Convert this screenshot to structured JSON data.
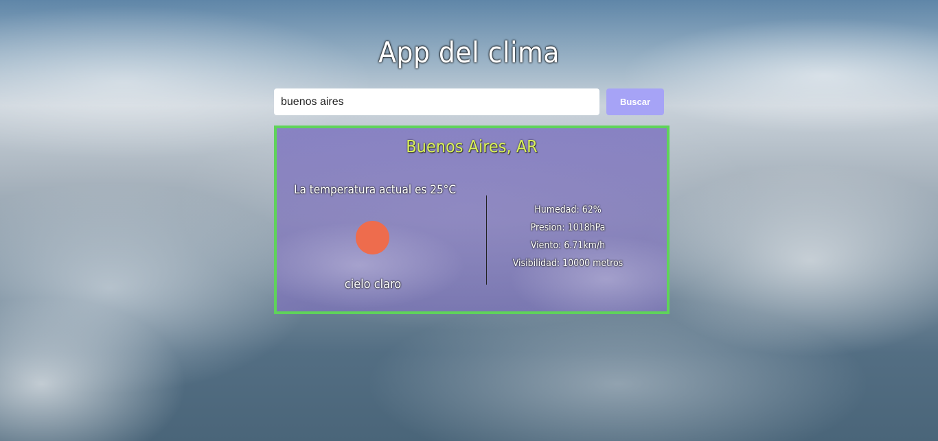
{
  "app": {
    "title": "App del clima"
  },
  "search": {
    "value": "buenos aires",
    "button_label": "Buscar"
  },
  "weather": {
    "city": "Buenos Aires, AR",
    "temperature_text": "La temperatura actual es 25°C",
    "icon": "sun-icon",
    "description": "cielo claro",
    "humidity": "Humedad: 62%",
    "pressure": "Presion: 1018hPa",
    "wind": "Viento: 6.71km/h",
    "visibility": "Visibilidad: 10000 metros"
  },
  "colors": {
    "card_border": "#5fd35a",
    "city_text": "#d9f05a",
    "button_bg": "#a6a3f6",
    "sun": "#ee6c4d"
  }
}
